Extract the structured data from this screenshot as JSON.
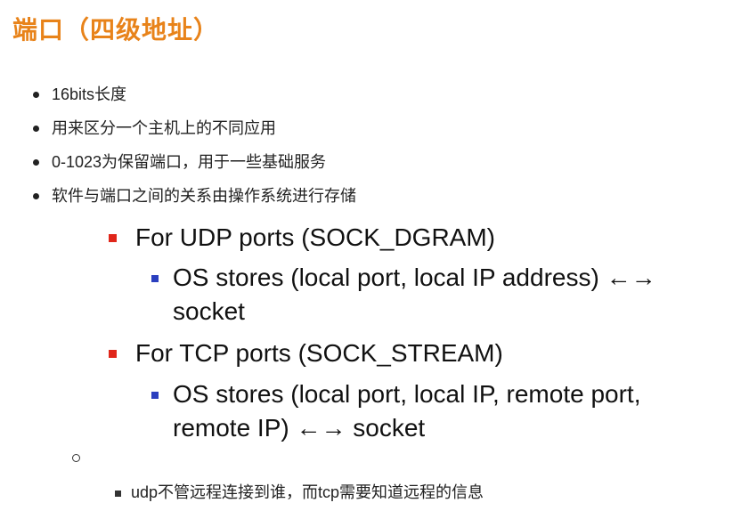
{
  "title": "端口（四级地址）",
  "bullets": [
    "16bits长度",
    "用来区分一个主机上的不同应用",
    "0-1023为保留端口，用于一些基础服务",
    "软件与端口之间的关系由操作系统进行存储"
  ],
  "udp": {
    "heading": "For UDP ports (SOCK_DGRAM)",
    "detail_line1": "OS stores (local port, local IP address) ←→",
    "detail_line2": "socket"
  },
  "tcp": {
    "heading": "For TCP ports (SOCK_STREAM)",
    "detail_line1": "OS stores (local port, local IP, remote port,",
    "detail_line2": "remote IP) ←→ socket"
  },
  "note": "udp不管远程连接到谁，而tcp需要知道远程的信息",
  "colors": {
    "title": "#E8831A",
    "red_marker": "#E0261A",
    "blue_marker": "#2B3FBF"
  }
}
